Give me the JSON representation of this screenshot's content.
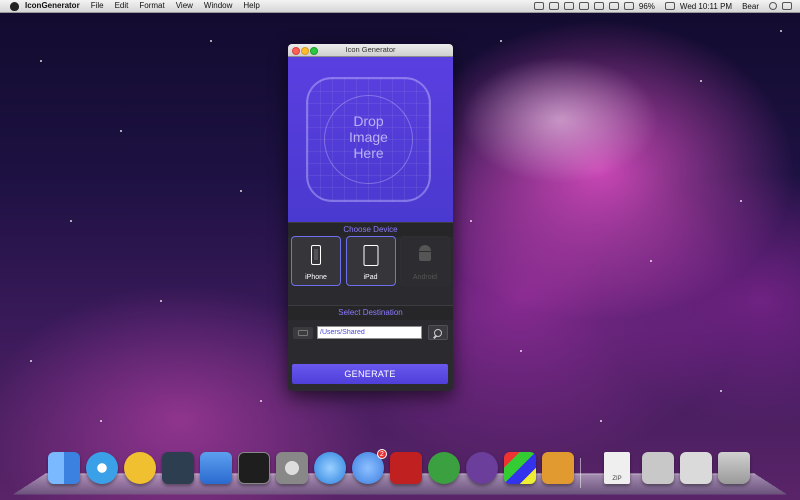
{
  "menubar": {
    "app_name": "IconGenerator",
    "menus": [
      "File",
      "Edit",
      "Format",
      "View",
      "Window",
      "Help"
    ],
    "battery": "96%",
    "clock": "Wed 10:11 PM",
    "user": "Bear"
  },
  "window": {
    "title": "Icon Generator",
    "drop_text": [
      "Drop",
      "Image",
      "Here"
    ],
    "choose_device_label": "Choose Device",
    "devices": [
      {
        "label": "iPhone",
        "icon": "iphone-icon",
        "selected": true
      },
      {
        "label": "iPad",
        "icon": "ipad-icon",
        "selected": true
      },
      {
        "label": "Android",
        "icon": "android-icon",
        "selected": false
      }
    ],
    "select_destination_label": "Select Destination",
    "destination_path": "/Users/Shared",
    "generate_label": "GENERATE"
  },
  "dock": {
    "items": [
      {
        "name": "finder",
        "color": "#4a8ff0"
      },
      {
        "name": "safari",
        "color": "#3aa0e8"
      },
      {
        "name": "coda",
        "color": "#e0b020"
      },
      {
        "name": "xcode-instruments",
        "color": "#2c3e50"
      },
      {
        "name": "xcode",
        "color": "#3b7fd6"
      },
      {
        "name": "terminal",
        "color": "#1e1e1e"
      },
      {
        "name": "system-preferences",
        "color": "#8a8a8a"
      },
      {
        "name": "itunes",
        "color": "#2a80e0"
      },
      {
        "name": "app-store",
        "color": "#3a8ef0",
        "badge": "2"
      },
      {
        "name": "filezilla",
        "color": "#c02020"
      },
      {
        "name": "sublime",
        "color": "#3aa040"
      },
      {
        "name": "github",
        "color": "#6a3e9a"
      },
      {
        "name": "colorsync",
        "color": "#d0d0d0"
      },
      {
        "name": "toast",
        "color": "#e09a30"
      },
      {
        "name": "archive",
        "color": "#e8e8e8"
      },
      {
        "name": "downloads-stack",
        "color": "#c8c8c8"
      },
      {
        "name": "documents-stack",
        "color": "#d8d8d8"
      },
      {
        "name": "trash",
        "color": "#b0b0b0"
      }
    ],
    "archive_label": "ZIP"
  },
  "colors": {
    "accent": "#5a3fe0",
    "accent_text": "#8b7bff"
  }
}
